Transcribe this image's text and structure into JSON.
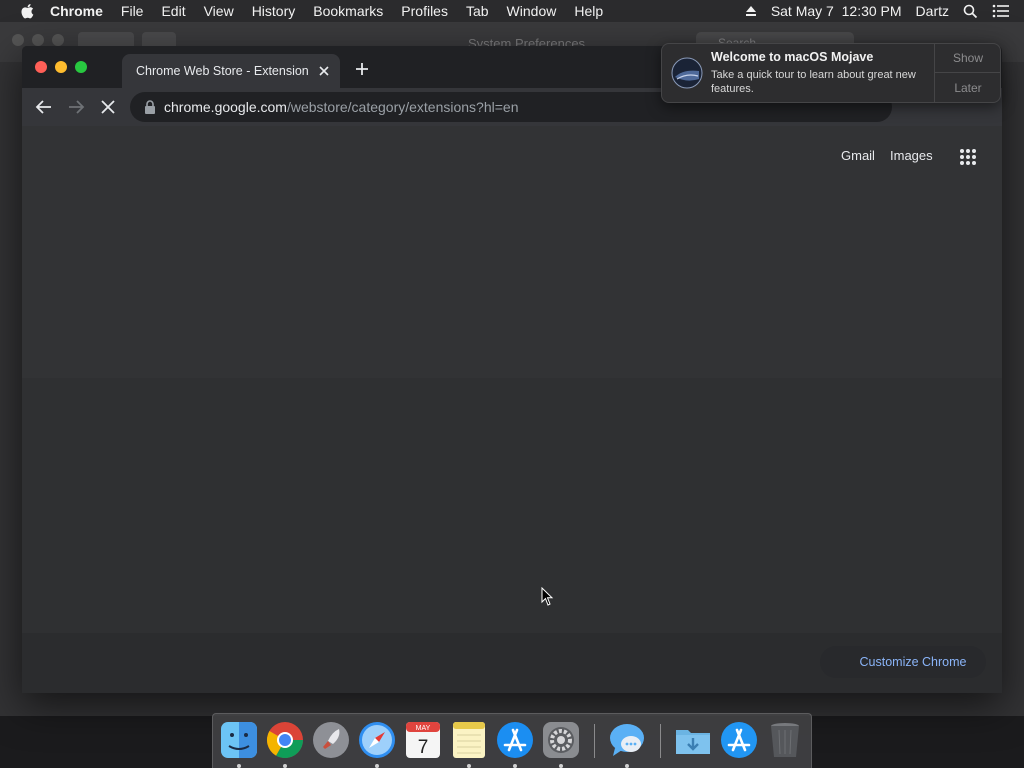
{
  "menubar": {
    "app_name": "Chrome",
    "items": [
      "File",
      "Edit",
      "View",
      "History",
      "Bookmarks",
      "Profiles",
      "Tab",
      "Window",
      "Help"
    ],
    "clock": "Sat May 7  12:30 PM",
    "user": "Dartz",
    "icons": [
      "apple-icon",
      "eject-icon",
      "spotlight-search-icon",
      "notification-center-icon"
    ]
  },
  "background_window": {
    "title": "System Preferences",
    "search_placeholder": "Search"
  },
  "chrome": {
    "tab": {
      "title": "Chrome Web Store - Extension",
      "icons": [
        "close-tab-icon"
      ]
    },
    "new_tab_icon": "plus-icon",
    "nav_icons": [
      "back-arrow-icon",
      "forward-arrow-icon",
      "stop-loading-icon"
    ],
    "omnibox": {
      "host": "chrome.google.com",
      "path": "/webstore/category/extensions?hl=en",
      "icon": "lock-icon"
    },
    "page": {
      "links": {
        "gmail": "Gmail",
        "images": "Images"
      },
      "apps_icon": "google-apps-grid-icon",
      "customize_label": "Customize Chrome",
      "customize_icon": "pencil-icon"
    }
  },
  "notification": {
    "title": "Welcome to macOS Mojave",
    "body": "Take a quick tour to learn about great new features.",
    "actions": {
      "show": "Show",
      "later": "Later"
    },
    "icon": "mojave-icon"
  },
  "dock": {
    "items": [
      {
        "name": "finder",
        "icon": "finder-icon",
        "running": true
      },
      {
        "name": "chrome",
        "icon": "chrome-icon",
        "running": true
      },
      {
        "name": "launchpad",
        "icon": "launchpad-icon",
        "running": false
      },
      {
        "name": "safari",
        "icon": "safari-icon",
        "running": true
      },
      {
        "name": "calendar",
        "icon": "calendar-icon",
        "running": false,
        "month": "MAY",
        "day": "7"
      },
      {
        "name": "notes",
        "icon": "notes-icon",
        "running": true
      },
      {
        "name": "app-store",
        "icon": "app-store-icon",
        "running": true
      },
      {
        "name": "system-preferences",
        "icon": "system-preferences-icon",
        "running": true
      },
      {
        "name": "messages",
        "icon": "messages-icon",
        "running": true
      },
      {
        "name": "downloads",
        "icon": "downloads-folder-icon",
        "running": false
      },
      {
        "name": "app-store-stack",
        "icon": "app-store-icon",
        "running": false
      },
      {
        "name": "trash",
        "icon": "trash-icon",
        "running": false
      }
    ]
  },
  "colors": {
    "accent_link": "#8ab4f8",
    "page_bg": "#323335",
    "toolbar_bg": "#35363a"
  }
}
